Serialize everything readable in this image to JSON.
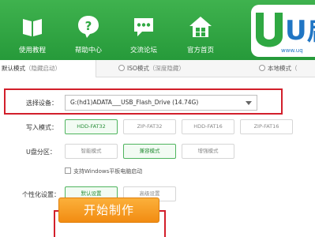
{
  "header": {
    "nav": [
      {
        "label": "使用教程",
        "icon": "book-icon"
      },
      {
        "label": "帮助中心",
        "icon": "help-icon"
      },
      {
        "label": "交流论坛",
        "icon": "chat-icon"
      },
      {
        "label": "官方首页",
        "icon": "home-icon"
      }
    ],
    "logo_text": "U启",
    "logo_url_text": "www.uq"
  },
  "tabs": [
    {
      "label": "默认模式",
      "sub": "（隐藏启动）"
    },
    {
      "label": "ISO模式",
      "sub": "（深度隐藏）"
    },
    {
      "label": "本地模式",
      "sub": "（"
    }
  ],
  "form": {
    "device_label": "选择设备：",
    "device_value": "G:(hd1)ADATA___USB_Flash_Drive (14.74G)",
    "write_mode_label": "写入模式：",
    "write_modes": [
      "HDD-FAT32",
      "ZIP-FAT32",
      "HDD-FAT16",
      "ZIP-FAT16"
    ],
    "partition_label": "U盘分区：",
    "partitions": [
      "智能模式",
      "兼容模式",
      "增强模式"
    ],
    "tablet_checkbox": "支持Windows平板电脑启动",
    "personalize_label": "个性化设置：",
    "personalize": [
      "默认设置",
      "高级设置"
    ],
    "start_button": "开始制作"
  },
  "colors": {
    "header_green": "#2fa842",
    "highlight_red": "#d21f2b",
    "start_orange": "#f5981e"
  }
}
